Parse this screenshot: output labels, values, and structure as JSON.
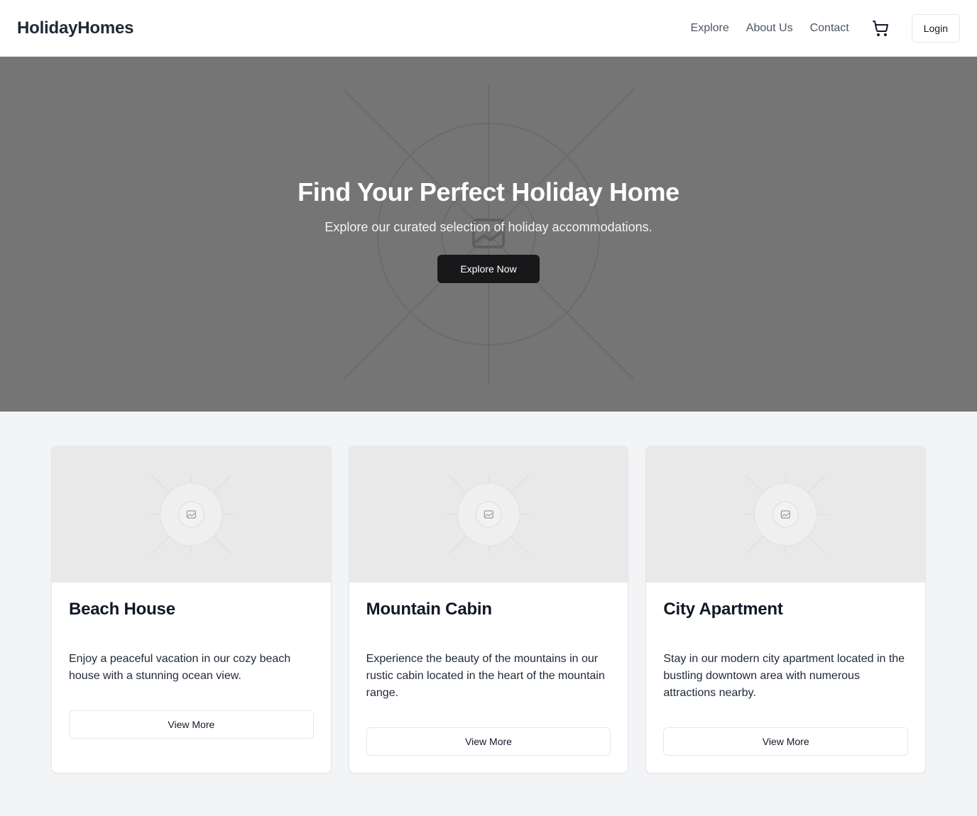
{
  "header": {
    "brand": "HolidayHomes",
    "nav": [
      "Explore",
      "About Us",
      "Contact"
    ],
    "cart_icon": "shopping-cart-icon",
    "login_label": "Login"
  },
  "hero": {
    "title": "Find Your Perfect Holiday Home",
    "subtitle": "Explore our curated selection of holiday accommodations.",
    "cta_label": "Explore Now",
    "image_icon": "image-placeholder-icon"
  },
  "cards": [
    {
      "title": "Beach House",
      "description": "Enjoy a peaceful vacation in our cozy beach house with a stunning ocean view.",
      "button_label": "View More"
    },
    {
      "title": "Mountain Cabin",
      "description": "Experience the beauty of the mountains in our rustic cabin located in the heart of the mountain range.",
      "button_label": "View More"
    },
    {
      "title": "City Apartment",
      "description": "Stay in our modern city apartment located in the bustling downtown area with numerous attractions nearby.",
      "button_label": "View More"
    }
  ],
  "colors": {
    "hero_bg": "#757575",
    "primary_button": "#18181b",
    "page_bg": "#f3f4f6"
  }
}
